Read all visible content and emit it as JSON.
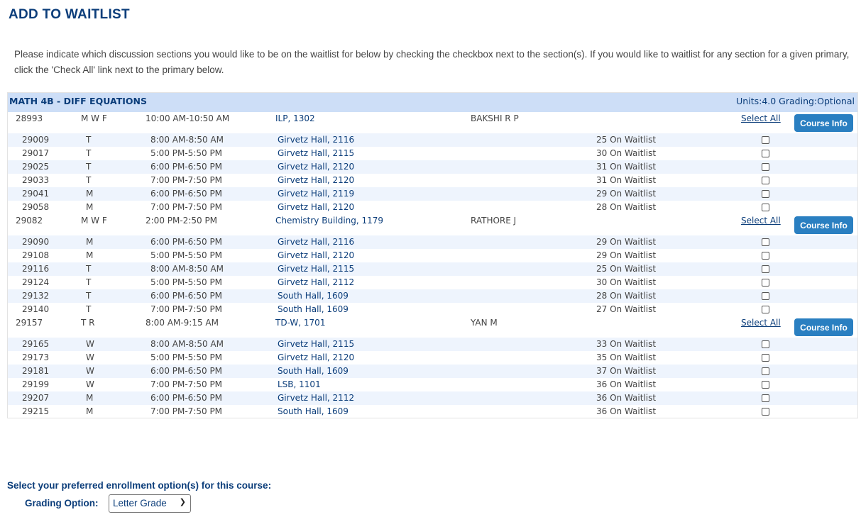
{
  "title": "ADD TO WAITLIST",
  "intro": "Please indicate which discussion sections you would like to be on the waitlist for below by checking the checkbox next to the section(s). If you would like to waitlist for any section for a given primary, click the 'Check All' link next to the primary below.",
  "course": {
    "name": "MATH 4B  - DIFF EQUATIONS",
    "units": "Units:4.0 Grading:Optional"
  },
  "select_all_label": "Select All",
  "course_info_label": "Course Info",
  "primaries": [
    {
      "id": "28993",
      "days": "M W F",
      "time": "10:00 AM-10:50 AM",
      "location": "ILP, 1302",
      "instructor": "BAKSHI R P",
      "sections": [
        {
          "id": "29009",
          "days": "T",
          "time": "8:00 AM-8:50 AM",
          "location": "Girvetz Hall, 2116",
          "waitlist": "25 On Waitlist"
        },
        {
          "id": "29017",
          "days": "T",
          "time": "5:00 PM-5:50 PM",
          "location": "Girvetz Hall, 2115",
          "waitlist": "30 On Waitlist"
        },
        {
          "id": "29025",
          "days": "T",
          "time": "6:00 PM-6:50 PM",
          "location": "Girvetz Hall, 2120",
          "waitlist": "31 On Waitlist"
        },
        {
          "id": "29033",
          "days": "T",
          "time": "7:00 PM-7:50 PM",
          "location": "Girvetz Hall, 2120",
          "waitlist": "31 On Waitlist"
        },
        {
          "id": "29041",
          "days": "M",
          "time": "6:00 PM-6:50 PM",
          "location": "Girvetz Hall, 2119",
          "waitlist": "29 On Waitlist"
        },
        {
          "id": "29058",
          "days": "M",
          "time": "7:00 PM-7:50 PM",
          "location": "Girvetz Hall, 2120",
          "waitlist": "28 On Waitlist"
        }
      ]
    },
    {
      "id": "29082",
      "days": "M W F",
      "time": "2:00 PM-2:50 PM",
      "location": "Chemistry Building, 1179",
      "instructor": "RATHORE J",
      "sections": [
        {
          "id": "29090",
          "days": "M",
          "time": "6:00 PM-6:50 PM",
          "location": "Girvetz Hall, 2116",
          "waitlist": "29 On Waitlist"
        },
        {
          "id": "29108",
          "days": "M",
          "time": "5:00 PM-5:50 PM",
          "location": "Girvetz Hall, 2120",
          "waitlist": "29 On Waitlist"
        },
        {
          "id": "29116",
          "days": "T",
          "time": "8:00 AM-8:50 AM",
          "location": "Girvetz Hall, 2115",
          "waitlist": "25 On Waitlist"
        },
        {
          "id": "29124",
          "days": "T",
          "time": "5:00 PM-5:50 PM",
          "location": "Girvetz Hall, 2112",
          "waitlist": "30 On Waitlist"
        },
        {
          "id": "29132",
          "days": "T",
          "time": "6:00 PM-6:50 PM",
          "location": "South Hall, 1609",
          "waitlist": "28 On Waitlist"
        },
        {
          "id": "29140",
          "days": "T",
          "time": "7:00 PM-7:50 PM",
          "location": "South Hall, 1609",
          "waitlist": "27 On Waitlist"
        }
      ]
    },
    {
      "id": "29157",
      "days": "T R",
      "time": "8:00 AM-9:15 AM",
      "location": "TD-W, 1701",
      "instructor": "YAN M",
      "sections": [
        {
          "id": "29165",
          "days": "W",
          "time": "8:00 AM-8:50 AM",
          "location": "Girvetz Hall, 2115",
          "waitlist": "33 On Waitlist"
        },
        {
          "id": "29173",
          "days": "W",
          "time": "5:00 PM-5:50 PM",
          "location": "Girvetz Hall, 2120",
          "waitlist": "35 On Waitlist"
        },
        {
          "id": "29181",
          "days": "W",
          "time": "6:00 PM-6:50 PM",
          "location": "South Hall, 1609",
          "waitlist": "37 On Waitlist"
        },
        {
          "id": "29199",
          "days": "W",
          "time": "7:00 PM-7:50 PM",
          "location": "LSB, 1101",
          "waitlist": "36 On Waitlist"
        },
        {
          "id": "29207",
          "days": "M",
          "time": "6:00 PM-6:50 PM",
          "location": "Girvetz Hall, 2112",
          "waitlist": "36 On Waitlist"
        },
        {
          "id": "29215",
          "days": "M",
          "time": "7:00 PM-7:50 PM",
          "location": "South Hall, 1609",
          "waitlist": "36 On Waitlist"
        }
      ]
    }
  ],
  "enrollment": {
    "prompt": "Select your preferred enrollment option(s) for this course:",
    "grading_label": "Grading Option:",
    "grading_value": "Letter Grade"
  }
}
